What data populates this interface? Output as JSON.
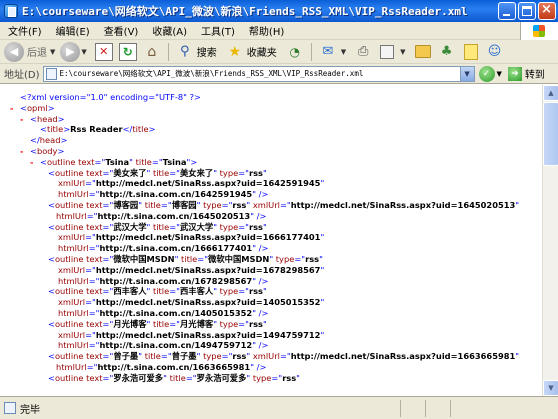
{
  "window": {
    "title": "E:\\courseware\\网络软文\\API_微波\\新浪\\Friends_RSS_XML\\VIP_RssReader.xml",
    "close_glyph": "×"
  },
  "menu": {
    "items": [
      "文件(F)",
      "编辑(E)",
      "查看(V)",
      "收藏(A)",
      "工具(T)",
      "帮助(H)"
    ]
  },
  "toolbar": {
    "back_label": "后退",
    "search_label": "搜索",
    "favorites_label": "收藏夹"
  },
  "address": {
    "label": "地址(D)",
    "value": "E:\\courseware\\网络软文\\API_微波\\新浪\\Friends_RSS_XML\\VIP_RssReader.xml",
    "go_label": "转到"
  },
  "xml": {
    "declaration": "<?xml version=\"1.0\" encoding=\"UTF-8\" ?>",
    "title_text": "Rss Reader",
    "root_outline": {
      "text": "Tsina",
      "title": "Tsina"
    },
    "outlines": [
      {
        "text": "美女来了",
        "title": "美女来了",
        "type": "rss",
        "xmlUrl": "http://medcl.net/SinaRss.aspx?uid=1642591945",
        "htmlUrl": "http://t.sina.com.cn/1642591945"
      },
      {
        "text": "博客园",
        "title": "博客园",
        "type": "rss",
        "xmlUrl": "http://medcl.net/SinaRss.aspx?uid=1645020513",
        "htmlUrl": "http://t.sina.com.cn/1645020513"
      },
      {
        "text": "武汉大学",
        "title": "武汉大学",
        "type": "rss",
        "xmlUrl": "http://medcl.net/SinaRss.aspx?uid=1666177401",
        "htmlUrl": "http://t.sina.com.cn/1666177401"
      },
      {
        "text": "微软中国MSDN",
        "title": "微软中国MSDN",
        "type": "rss",
        "xmlUrl": "http://medcl.net/SinaRss.aspx?uid=1678298567",
        "htmlUrl": "http://t.sina.com.cn/1678298567"
      },
      {
        "text": "西丰客人",
        "title": "西丰客人",
        "type": "rss",
        "xmlUrl": "http://medcl.net/SinaRss.aspx?uid=1405015352",
        "htmlUrl": "http://t.sina.com.cn/1405015352"
      },
      {
        "text": "月光博客",
        "title": "月光博客",
        "type": "rss",
        "xmlUrl": "http://medcl.net/SinaRss.aspx?uid=1494759712",
        "htmlUrl": "http://t.sina.com.cn/1494759712"
      },
      {
        "text": "曾子墨",
        "title": "曾子墨",
        "type": "rss",
        "xmlUrl": "http://medcl.net/SinaRss.aspx?uid=1663665981",
        "htmlUrl": "http://t.sina.com.cn/1663665981"
      },
      {
        "text": "罗永浩可爱多",
        "title": "罗永浩可爱多",
        "type": "rss"
      }
    ]
  },
  "status": {
    "text": "完毕"
  }
}
